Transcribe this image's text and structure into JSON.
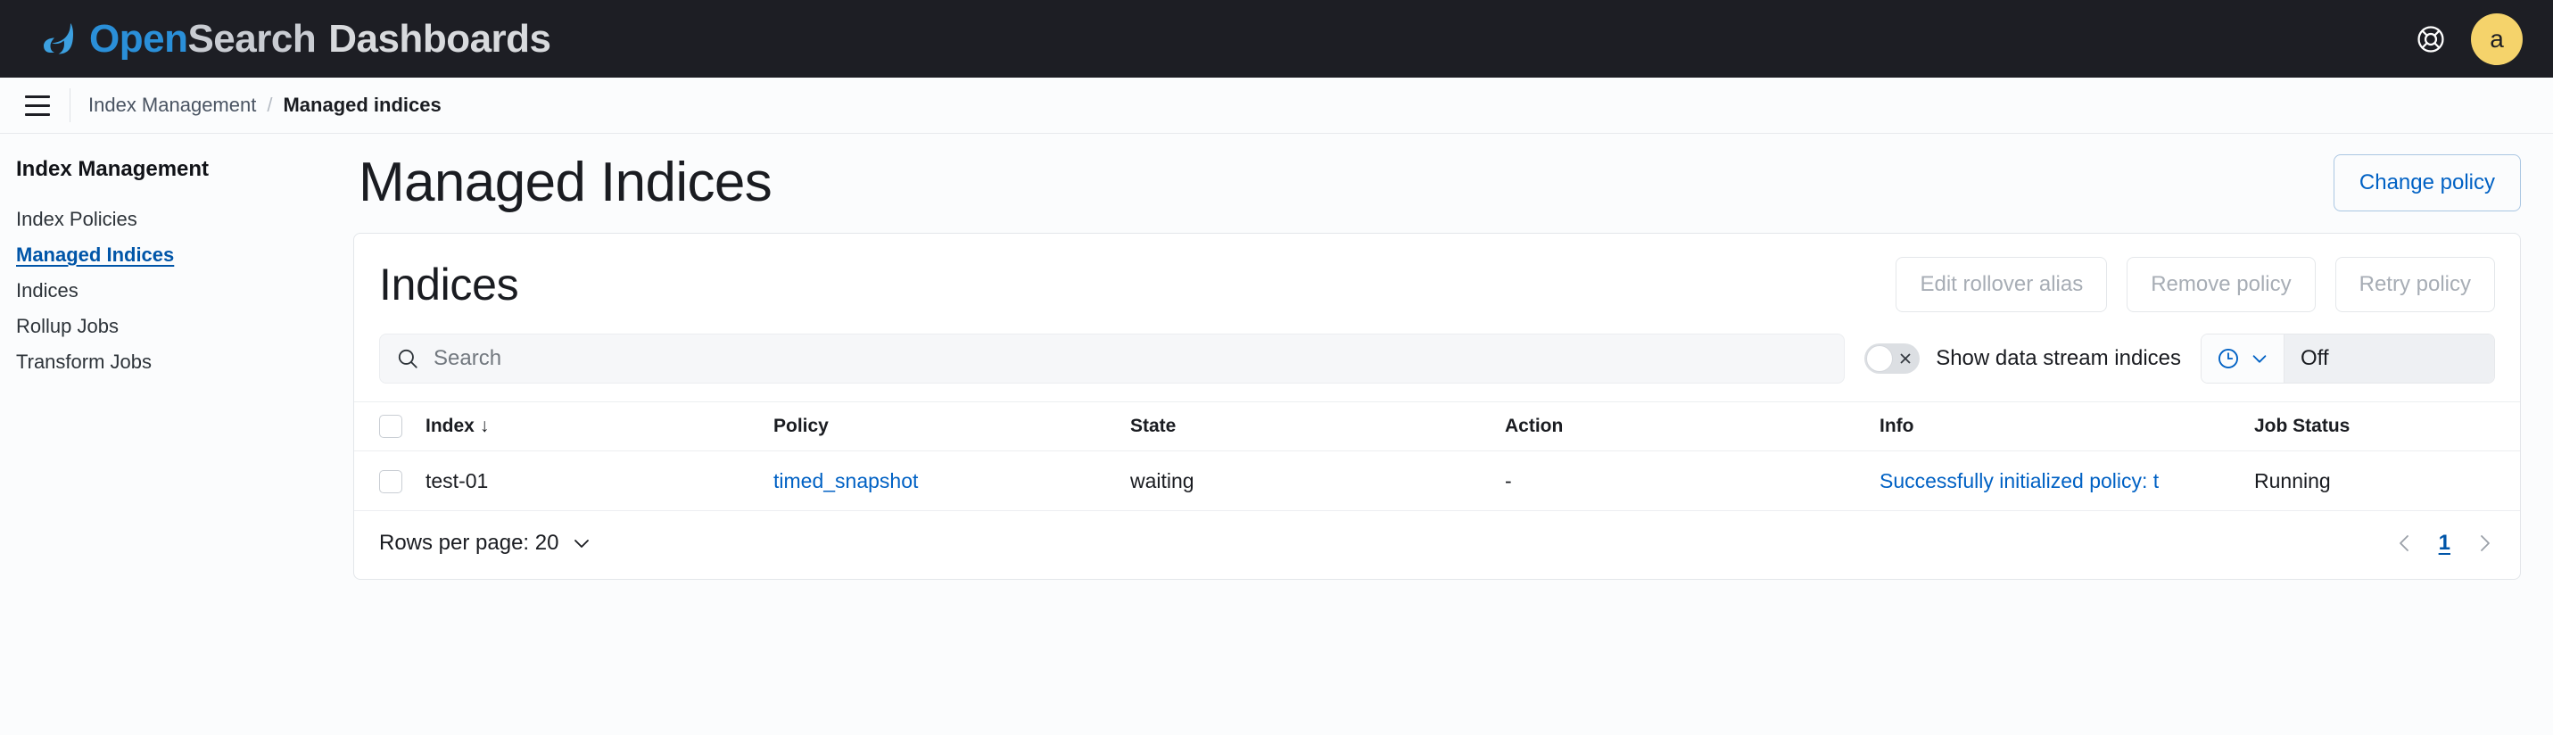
{
  "header": {
    "brand_open": "Open",
    "brand_search": "Search",
    "brand_dashboards": "Dashboards",
    "help_icon": "help-lifebuoy-icon",
    "avatar_initial": "a",
    "background": "#1d1e24",
    "accent": "#2a8fd8",
    "avatar_color": "#f5d36b"
  },
  "breadcrumb": {
    "menu_icon": "hamburger-menu-icon",
    "parent": "Index Management",
    "separator": "/",
    "current": "Managed indices"
  },
  "sidebar": {
    "title": "Index Management",
    "items": [
      {
        "label": "Index Policies",
        "active": false
      },
      {
        "label": "Managed Indices",
        "active": true
      },
      {
        "label": "Indices",
        "active": false
      },
      {
        "label": "Rollup Jobs",
        "active": false
      },
      {
        "label": "Transform Jobs",
        "active": false
      }
    ],
    "active_color": "#0055a8"
  },
  "page": {
    "title": "Managed Indices",
    "change_policy_label": "Change policy"
  },
  "panel": {
    "title": "Indices",
    "actions": [
      {
        "label": "Edit rollover alias",
        "disabled": true
      },
      {
        "label": "Remove policy",
        "disabled": true
      },
      {
        "label": "Retry policy",
        "disabled": true
      }
    ]
  },
  "controls": {
    "search_icon": "search-icon",
    "search_value": "",
    "search_placeholder": "Search",
    "toggle_label": "Show data stream indices",
    "toggle_state": "off",
    "refresh_icon": "clock-icon",
    "refresh_chevron": "chevron-down-icon",
    "refresh_value": "Off"
  },
  "table": {
    "columns": [
      {
        "key": "index",
        "label": "Index",
        "sorted": true,
        "sort_dir": "↓"
      },
      {
        "key": "policy",
        "label": "Policy"
      },
      {
        "key": "state",
        "label": "State"
      },
      {
        "key": "action",
        "label": "Action"
      },
      {
        "key": "info",
        "label": "Info"
      },
      {
        "key": "job_status",
        "label": "Job Status"
      }
    ],
    "rows": [
      {
        "index": "test-01",
        "policy": "timed_snapshot",
        "state": "waiting",
        "action": "-",
        "info": "Successfully initialized policy: t",
        "job_status": "Running"
      }
    ]
  },
  "footer": {
    "rows_per_page_label": "Rows per page: 20",
    "rows_per_page_chevron": "chevron-down-icon",
    "prev_icon": "chevron-left-icon",
    "next_icon": "chevron-right-icon",
    "current_page": "1"
  }
}
